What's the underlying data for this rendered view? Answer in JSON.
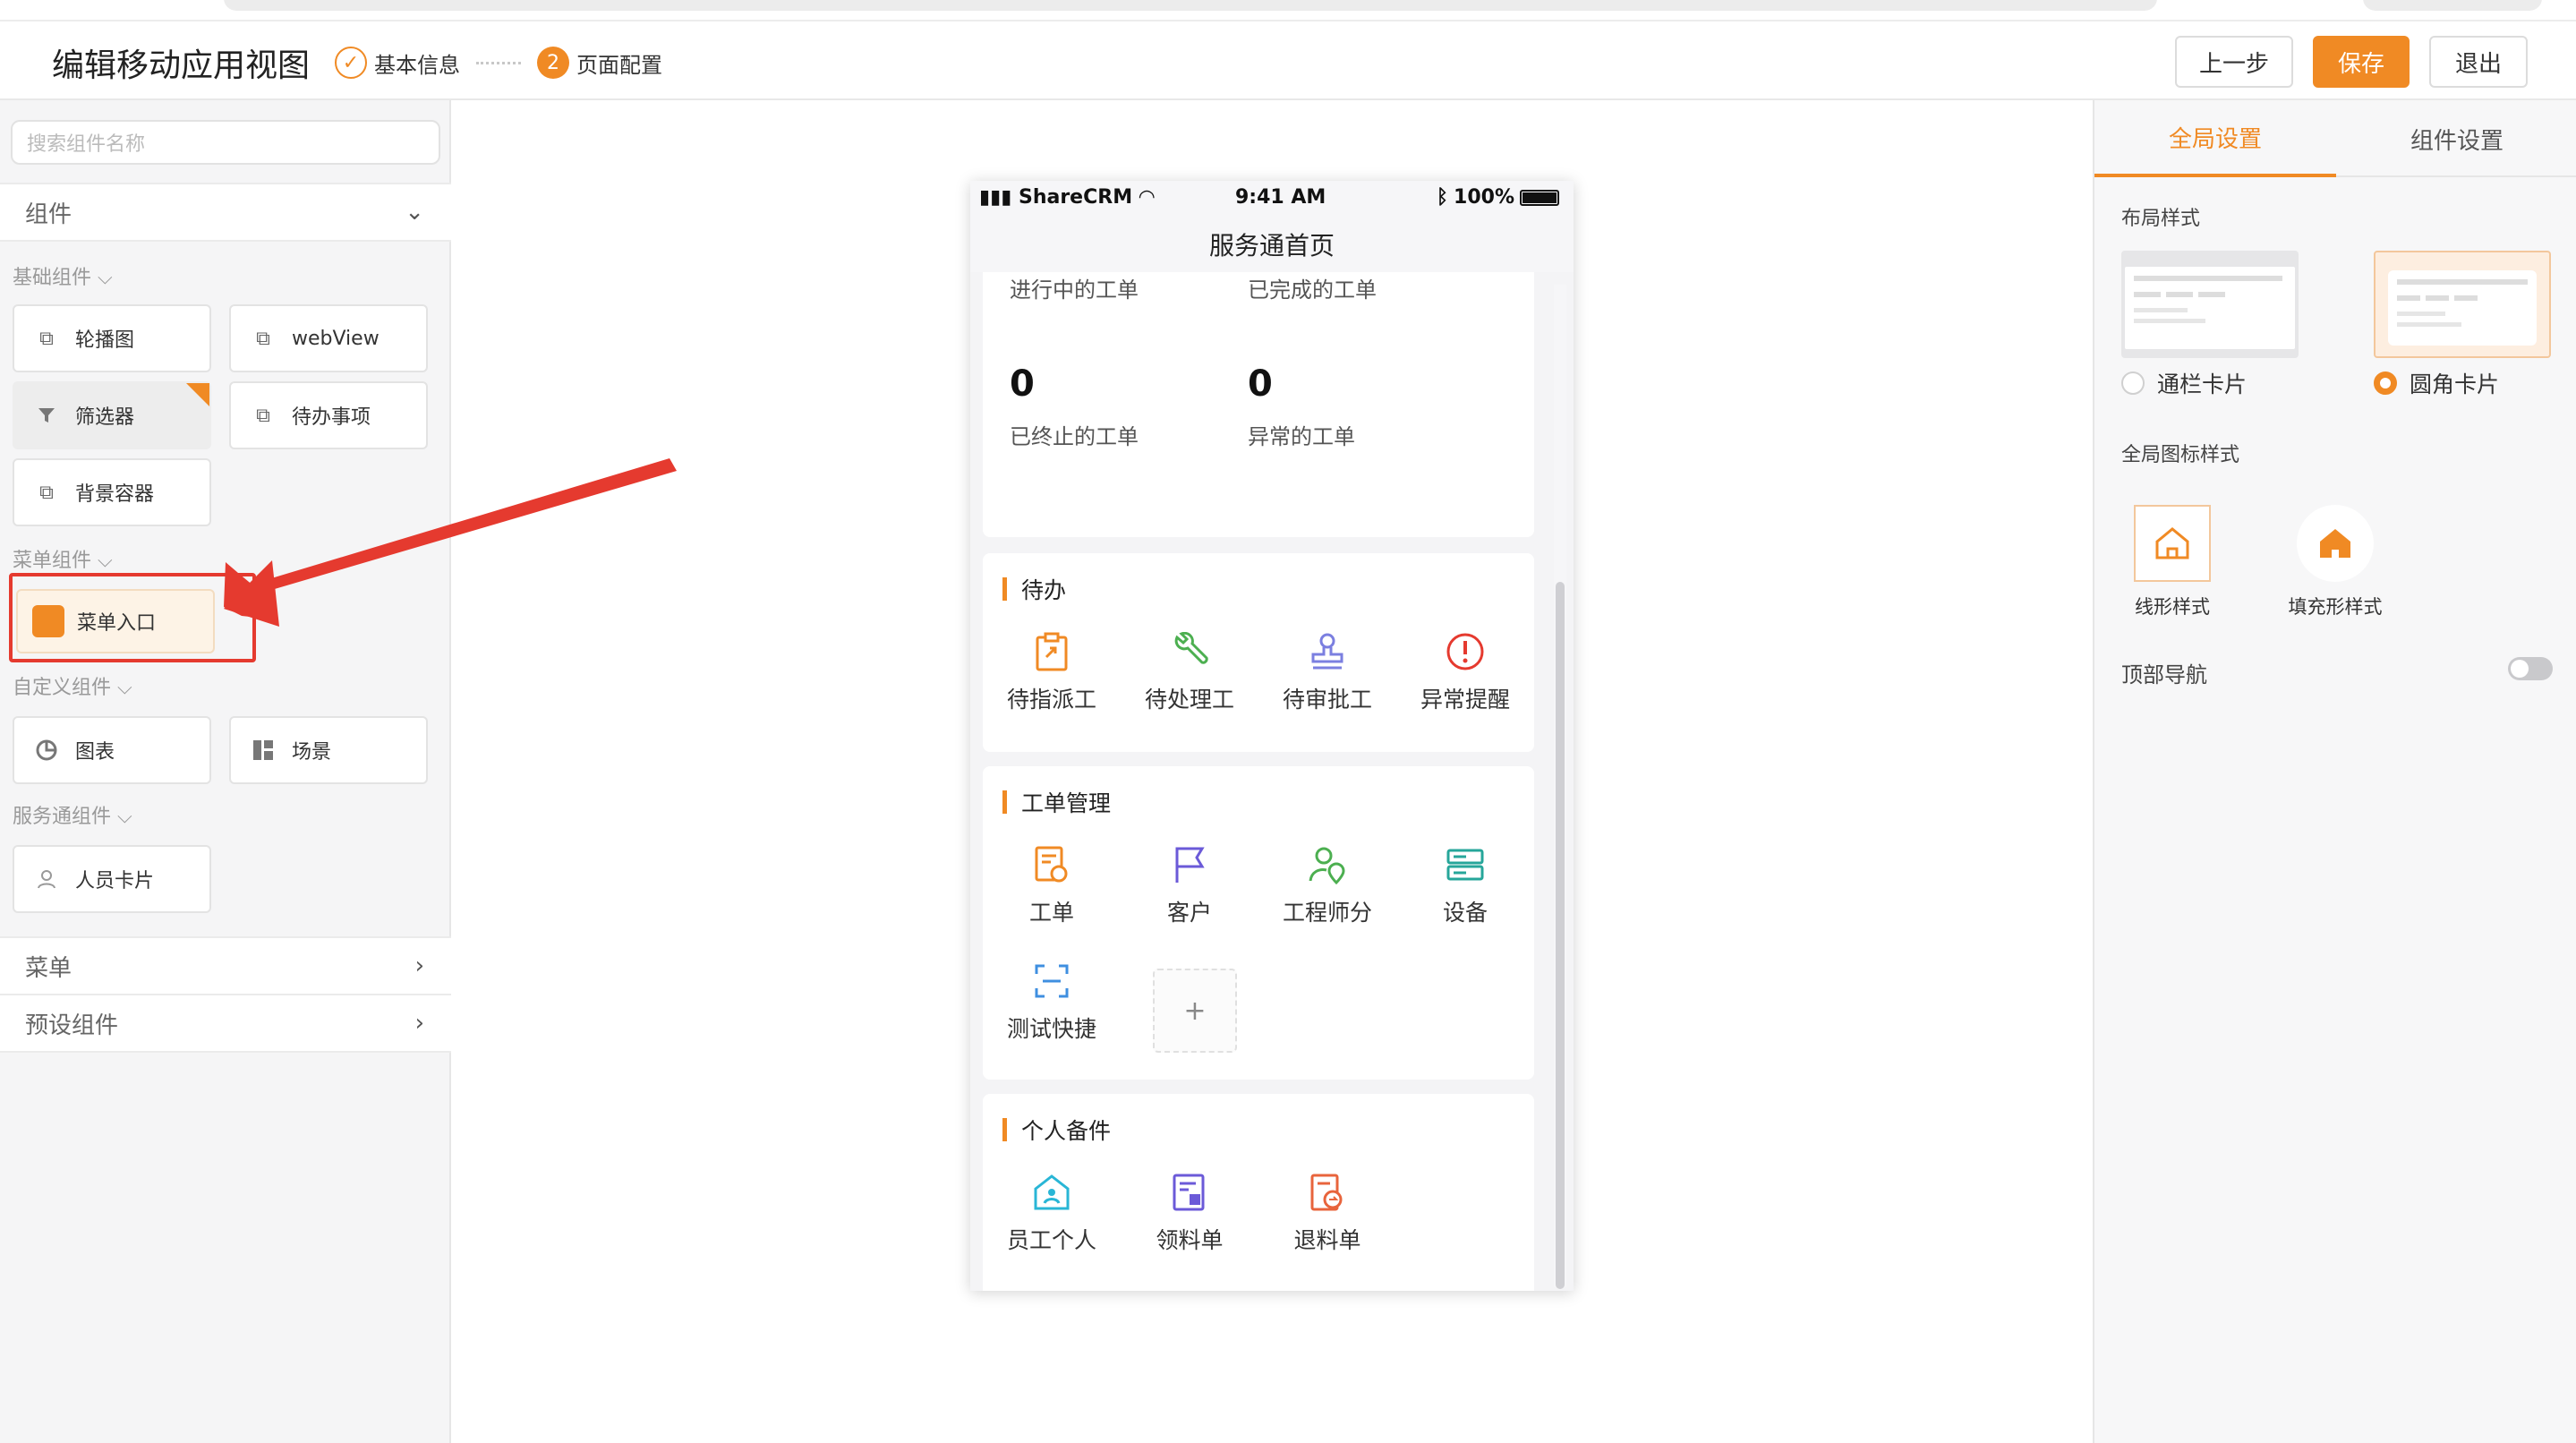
{
  "header": {
    "title": "编辑移动应用视图",
    "steps": [
      {
        "label": "基本信息",
        "state": "done"
      },
      {
        "num": "2",
        "label": "页面配置",
        "state": "active"
      }
    ],
    "prev_label": "上一步",
    "save_label": "保存",
    "exit_label": "退出"
  },
  "sidebar": {
    "search_placeholder": "搜索组件名称",
    "components_header": "组件",
    "groups": {
      "basic": "基础组件",
      "menu": "菜单组件",
      "custom": "自定义组件",
      "service": "服务通组件"
    },
    "basic_items": [
      "轮播图",
      "webView",
      "筛选器",
      "待办事项",
      "背景容器"
    ],
    "menu_items": [
      "菜单入口"
    ],
    "custom_items": [
      "图表",
      "场景"
    ],
    "service_items": [
      "人员卡片"
    ],
    "bottom_rows": [
      "菜单",
      "预设组件"
    ]
  },
  "phone": {
    "status": {
      "carrier": "ShareCRM",
      "time": "9:41 AM",
      "battery": "100%"
    },
    "nav_title": "服务通首页",
    "stats": [
      {
        "label": "进行中的工单"
      },
      {
        "label": "已完成的工单"
      },
      {
        "value": "0",
        "label": "已终止的工单"
      },
      {
        "value": "0",
        "label": "异常的工单"
      }
    ],
    "sections": [
      {
        "title": "待办",
        "items": [
          "待指派工",
          "待处理工",
          "待审批工",
          "异常提醒"
        ]
      },
      {
        "title": "工单管理",
        "items": [
          "工单",
          "客户",
          "工程师分",
          "设备",
          "测试快捷"
        ],
        "add": "+"
      },
      {
        "title": "个人备件",
        "items": [
          "员工个人",
          "领料单",
          "退料单"
        ]
      }
    ]
  },
  "rpanel": {
    "tabs": [
      "全局设置",
      "组件设置"
    ],
    "layout_label": "布局样式",
    "layout_options": [
      "通栏卡片",
      "圆角卡片"
    ],
    "layout_selected": "圆角卡片",
    "icon_label": "全局图标样式",
    "icon_options": [
      "线形样式",
      "填充形样式"
    ],
    "top_nav_label": "顶部导航",
    "top_nav_on": false
  },
  "colors": {
    "accent": "#f08a24",
    "annotation": "#e53a2f"
  }
}
